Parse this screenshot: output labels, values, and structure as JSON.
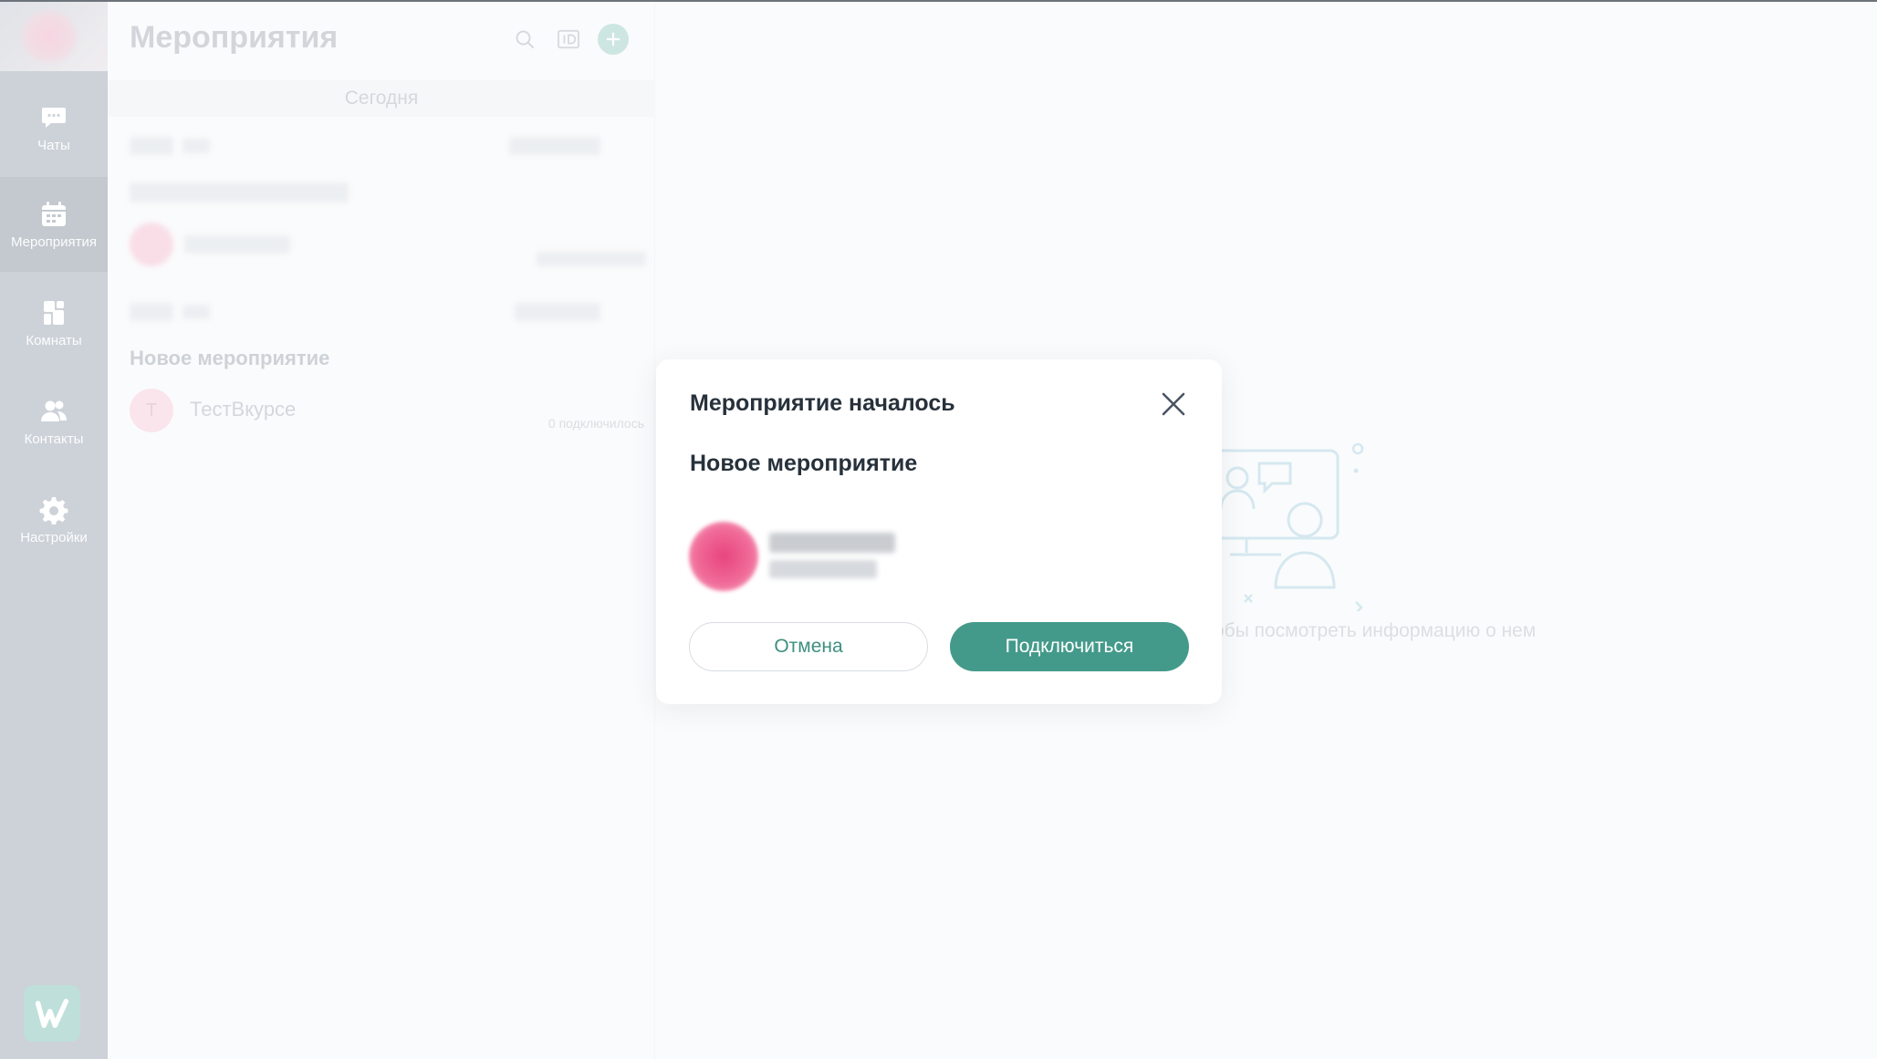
{
  "nav": {
    "items": [
      {
        "label": "Чаты",
        "icon": "chat-icon"
      },
      {
        "label": "Мероприятия",
        "icon": "calendar-icon",
        "active": true
      },
      {
        "label": "Комнаты",
        "icon": "rooms-icon"
      },
      {
        "label": "Контакты",
        "icon": "contacts-icon"
      },
      {
        "label": "Настройки",
        "icon": "gear-icon"
      }
    ]
  },
  "panel": {
    "title": "Мероприятия",
    "day_separator": "Сегодня",
    "group_title": "Новое мероприятие",
    "event": {
      "avatar_letter": "Т",
      "name": "ТестВкурсе",
      "meta": "0 подключилось"
    }
  },
  "empty_state": {
    "text": "обы посмотреть информацию о нем"
  },
  "modal": {
    "title": "Мероприятие началось",
    "event_name": "Новое мероприятие",
    "cancel_label": "Отмена",
    "join_label": "Подключиться"
  },
  "colors": {
    "accent": "#449a8a",
    "rail": "#aab2bd",
    "avatar_pink": "#e8457d"
  }
}
